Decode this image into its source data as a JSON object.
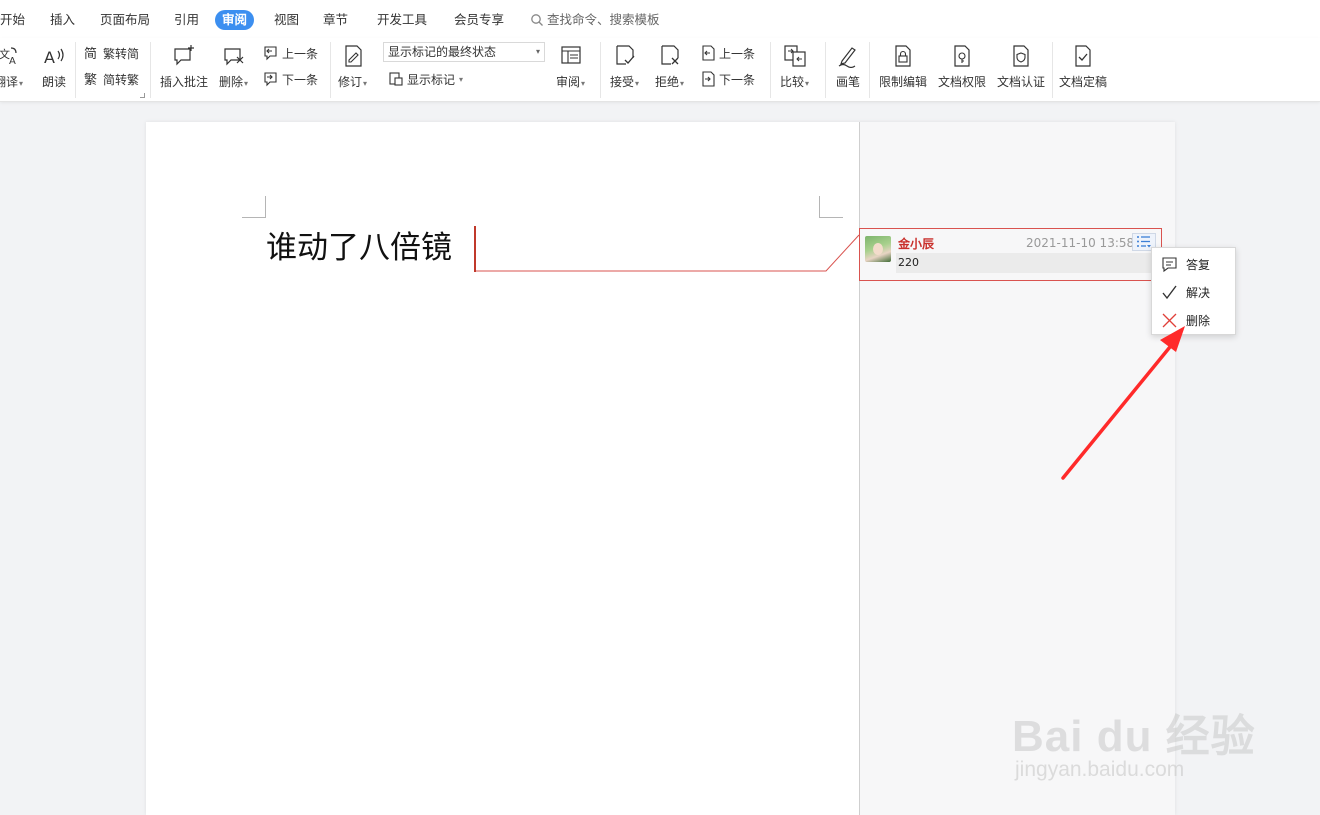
{
  "tabs": [
    {
      "label": "开始"
    },
    {
      "label": "插入"
    },
    {
      "label": "页面布局"
    },
    {
      "label": "引用"
    },
    {
      "label": "审阅"
    },
    {
      "label": "视图"
    },
    {
      "label": "章节"
    },
    {
      "label": "开发工具"
    },
    {
      "label": "会员专享"
    }
  ],
  "active_tab": "审阅",
  "search": {
    "placeholder": "查找命令、搜索模板"
  },
  "ribbon": {
    "translate": "翻译",
    "read_aloud": "朗读",
    "trad_to_simp": "繁转简",
    "simp_to_trad": "简转繁",
    "insert_comment": "插入批注",
    "delete": "删除",
    "prev": "上一条",
    "next": "下一条",
    "track_changes": "修订",
    "markup_state": "显示标记的最终状态",
    "show_markup": "显示标记",
    "review_pane": "审阅",
    "accept": "接受",
    "reject": "拒绝",
    "prev2": "上一条",
    "next2": "下一条",
    "compare": "比较",
    "ink": "画笔",
    "restrict_editing": "限制编辑",
    "doc_permissions": "文档权限",
    "doc_certify": "文档认证",
    "doc_finalize": "文档定稿"
  },
  "document": {
    "text": "谁动了八倍镜"
  },
  "comment": {
    "author": "金小辰",
    "timestamp": "2021-11-10 13:58",
    "body": "220"
  },
  "context_menu": {
    "items": [
      {
        "label": "答复",
        "icon": "reply-icon"
      },
      {
        "label": "解决",
        "icon": "check-icon"
      },
      {
        "label": "删除",
        "icon": "delete-x-icon"
      }
    ]
  },
  "watermark": {
    "logo": "Bai du 经验",
    "url": "jingyan.baidu.com"
  },
  "colors": {
    "accent": "#3c8ff0",
    "comment_border": "#d9534f",
    "author": "#c9302c",
    "arrow": "#ff2a2a"
  }
}
